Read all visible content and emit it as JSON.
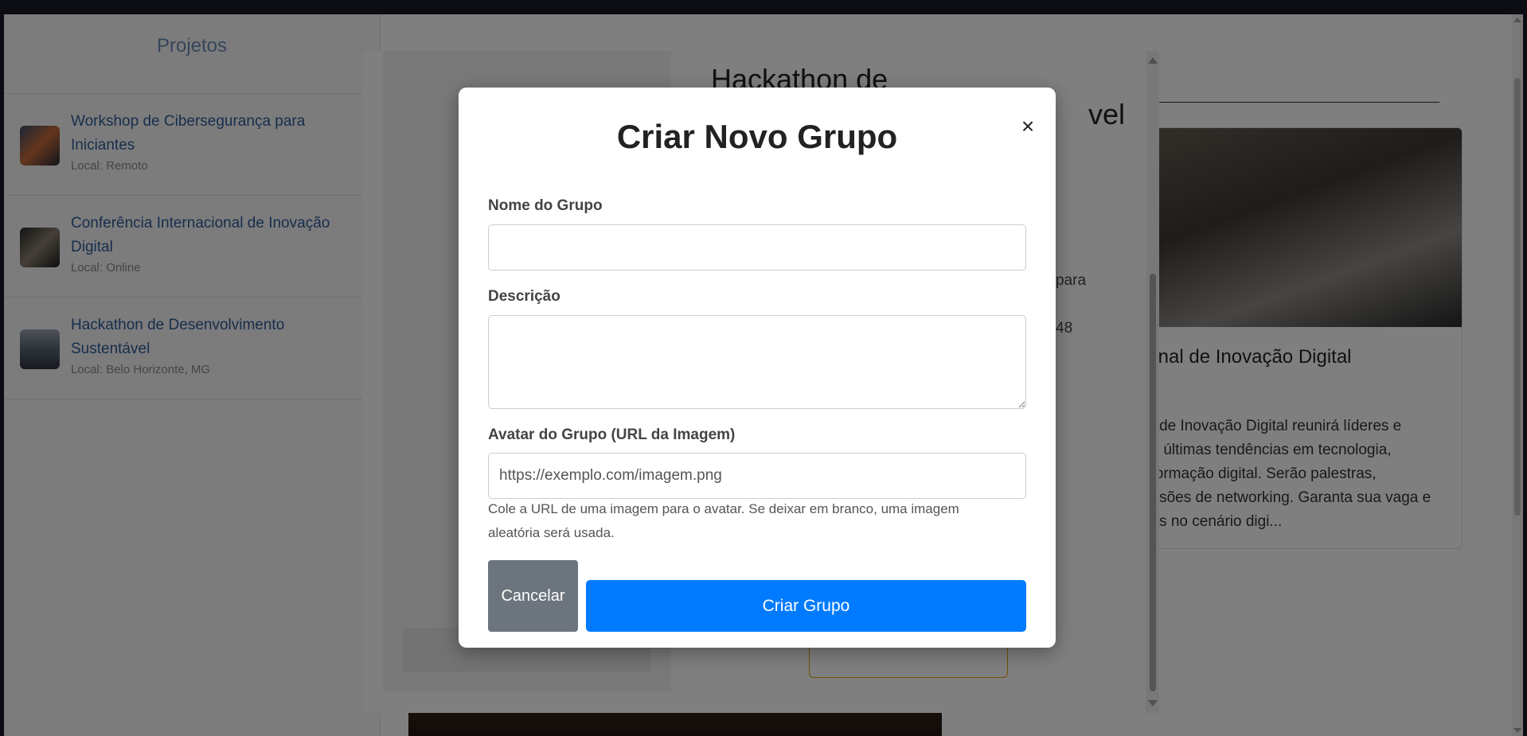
{
  "sidebar": {
    "title": "Projetos",
    "projects": [
      {
        "title": "Workshop de Cibersegurança para Iniciantes",
        "location": "Local: Remoto"
      },
      {
        "title": "Conferência Internacional de Inovação Digital",
        "location": "Local: Online"
      },
      {
        "title": "Hackathon de Desenvolvimento Sustentável",
        "location": "Local: Belo Horizonte, MG"
      }
    ]
  },
  "detail": {
    "title_line1": "Hackathon de",
    "title_line2_end": "vel",
    "text1": "para",
    "text2": "48"
  },
  "card": {
    "title": "ional de Inovação Digital",
    "desc_lines": [
      "al de Inovação Digital reunirá líderes e",
      "as últimas tendências em tecnologia,",
      "sformação digital. Serão palestras,",
      "essões de networking. Garanta sua vaga e",
      "ças no cenário digi..."
    ]
  },
  "modal": {
    "title": "Criar Novo Grupo",
    "close_icon": "×",
    "name_label": "Nome do Grupo",
    "name_value": "",
    "description_label": "Descrição",
    "description_value": "",
    "avatar_label": "Avatar do Grupo (URL da Imagem)",
    "avatar_placeholder": "https://exemplo.com/imagem.png",
    "avatar_help": "Cole a URL de uma imagem para o avatar. Se deixar em branco, uma imagem aleatória será usada.",
    "cancel_label": "Cancelar",
    "create_label": "Criar Grupo"
  },
  "colors": {
    "primary": "#007bff",
    "secondary": "#6c757d",
    "overlay": "rgba(0,0,0,0.5)"
  }
}
